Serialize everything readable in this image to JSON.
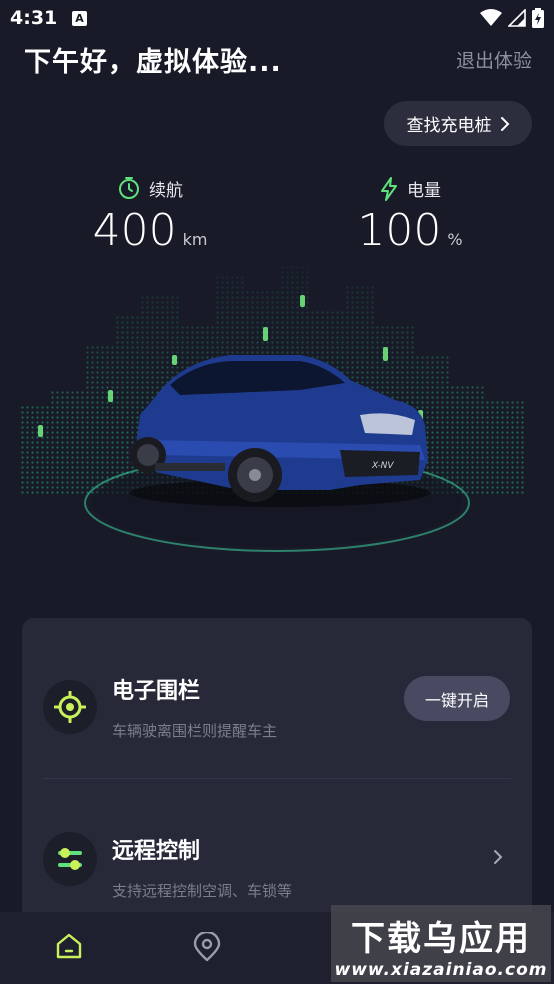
{
  "status_bar": {
    "time": "4:31",
    "notification_badge": "A",
    "icons": [
      "wifi-icon",
      "cell-signal-icon",
      "battery-icon"
    ]
  },
  "header": {
    "greeting": "下午好，虚拟体验...",
    "exit_label": "退出体验",
    "charger_label": "查找充电桩"
  },
  "stats": {
    "range": {
      "label": "续航",
      "value": "400",
      "unit": "km",
      "icon": "timer-icon"
    },
    "battery": {
      "label": "电量",
      "value": "100",
      "unit": "%",
      "icon": "lightning-icon"
    }
  },
  "features": {
    "fence": {
      "title": "电子围栏",
      "description": "车辆驶离围栏则提醒车主",
      "button_label": "一键开启",
      "icon": "location-target-icon"
    },
    "remote": {
      "title": "远程控制",
      "description": "支持远程控制空调、车锁等",
      "icon": "sliders-icon"
    }
  },
  "bottom_nav": {
    "items": [
      "home-icon",
      "location-pin-icon"
    ]
  },
  "watermark": {
    "title": "下载乌应用",
    "url": "www.xiazainiao.com"
  },
  "colors": {
    "background": "#181a28",
    "card": "#272938",
    "accent_green": "#5fe07a",
    "accent_yellow_green": "#c9f25a"
  }
}
